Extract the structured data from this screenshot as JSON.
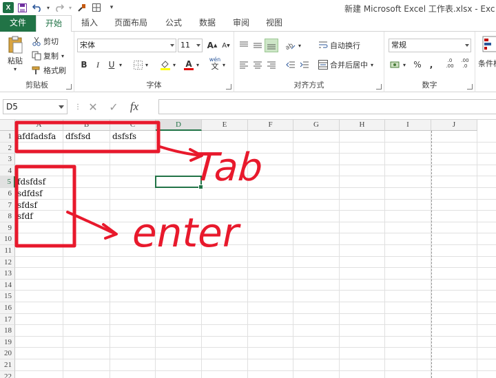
{
  "window": {
    "title": "新建 Microsoft Excel 工作表.xlsx - Exc"
  },
  "tabs": [
    {
      "label": "文件"
    },
    {
      "label": "开始"
    },
    {
      "label": "插入"
    },
    {
      "label": "页面布局"
    },
    {
      "label": "公式"
    },
    {
      "label": "数据"
    },
    {
      "label": "审阅"
    },
    {
      "label": "视图"
    }
  ],
  "ribbon": {
    "clipboard": {
      "paste": "粘贴",
      "cut": "剪切",
      "copy": "复制",
      "format_painter": "格式刷",
      "label": "剪贴板"
    },
    "font": {
      "name": "宋体",
      "size": "11",
      "label": "字体",
      "bold": "B",
      "italic": "I",
      "underline": "U",
      "grow": "A",
      "shrink": "A",
      "font_color_glyph": "A",
      "wen": "wén",
      "wen_char": "文"
    },
    "alignment": {
      "wrap": "自动换行",
      "merge": "合并后居中",
      "label": "对齐方式"
    },
    "number": {
      "format": "常规",
      "label": "数字",
      "percent": "%",
      "comma": ",",
      "inc_decimal": ".0 .00",
      "dec_decimal": ".00 .0"
    },
    "styles": {
      "conditional": "条件格"
    }
  },
  "formula_bar": {
    "name_box": "D5",
    "cancel": "✕",
    "enter": "✓",
    "fx": "fx",
    "value": ""
  },
  "sheet": {
    "columns": [
      "A",
      "B",
      "C",
      "D",
      "E",
      "F",
      "G",
      "H",
      "I",
      "J"
    ],
    "rows": [
      "1",
      "2",
      "3",
      "4",
      "5",
      "6",
      "7",
      "8",
      "9",
      "10",
      "11",
      "12",
      "13",
      "14",
      "15",
      "16",
      "17",
      "18",
      "19",
      "20",
      "21",
      "22"
    ],
    "selected_cell": "D5",
    "cells": {
      "A1": "afdfadsfa",
      "B1": "dfsfsd",
      "C1": "dsfsfs",
      "A5": "fdsfdsf",
      "A6": "sdfdsf",
      "A7": "sfdsf",
      "A8": "sfdf"
    }
  },
  "annotations": {
    "tab_text": "Tab",
    "enter_text": "enter",
    "color": "#e8192c"
  },
  "colors": {
    "accent": "#217346",
    "annotation": "#e8192c"
  }
}
